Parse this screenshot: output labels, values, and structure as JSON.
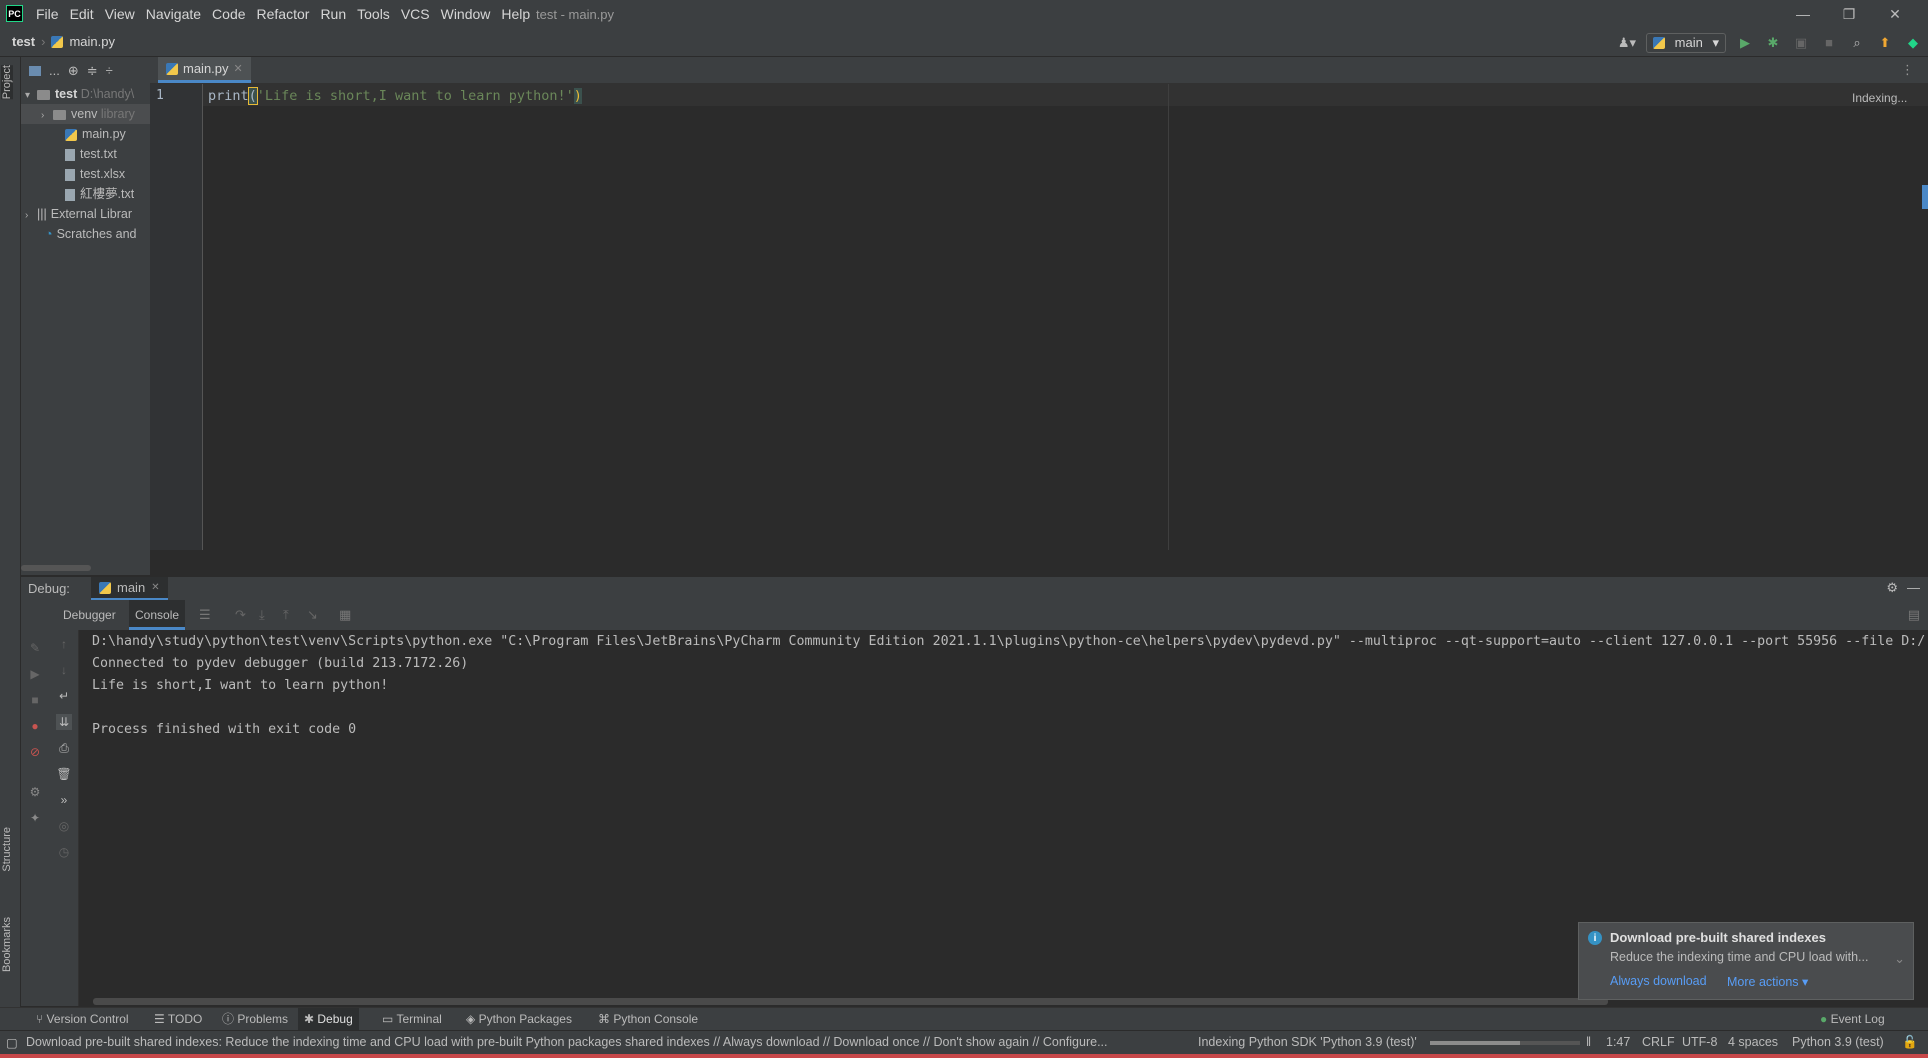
{
  "app": {
    "logo_text": "PC",
    "window_title": "test - main.py",
    "accent_color": "#4a88c7"
  },
  "menu": {
    "items": [
      "File",
      "Edit",
      "View",
      "Navigate",
      "Code",
      "Refactor",
      "Run",
      "Tools",
      "VCS",
      "Window",
      "Help"
    ]
  },
  "window_controls": {
    "minimize": "—",
    "restore": "❐",
    "close": "✕"
  },
  "navbar": {
    "project": "test",
    "file": "main.py",
    "run_config": "main"
  },
  "sidebar": {
    "project_tab": "Project",
    "structure_tab": "Structure",
    "bookmarks_tab": "Bookmarks"
  },
  "project_tree": {
    "root_name": "test",
    "root_path": "D:\\handy\\",
    "items": [
      {
        "name": "venv",
        "hint": "library"
      },
      {
        "name": "main.py"
      },
      {
        "name": "test.txt"
      },
      {
        "name": "test.xlsx"
      },
      {
        "name": "紅樓夢.txt"
      },
      {
        "name": "External Librar"
      },
      {
        "name": "Scratches and"
      }
    ],
    "toolbar_label": "..."
  },
  "editor": {
    "tab_label": "main.py",
    "line_number": "1",
    "code_func": "print",
    "code_open": "(",
    "code_string": "'Life is short,I want to learn python!'",
    "code_close": ")",
    "status_right": "Indexing..."
  },
  "debug": {
    "label": "Debug:",
    "session": "main",
    "subtab_debugger": "Debugger",
    "subtab_console": "Console",
    "console_lines": [
      "D:\\handy\\study\\python\\test\\venv\\Scripts\\python.exe \"C:\\Program Files\\JetBrains\\PyCharm Community Edition 2021.1.1\\plugins\\python-ce\\helpers\\pydev\\pydevd.py\" --multiproc --qt-support=auto --client 127.0.0.1 --port 55956 --file D:/",
      "Connected to pydev debugger (build 213.7172.26)",
      "Life is short,I want to learn python!",
      "",
      "Process finished with exit code 0"
    ]
  },
  "notification": {
    "title": "Download pre-built shared indexes",
    "body": "Reduce the indexing time and CPU load with...",
    "link_always": "Always download",
    "link_more": "More actions ▾"
  },
  "bottom_tabs": [
    "Version Control",
    "TODO",
    "Problems",
    "Debug",
    "Terminal",
    "Python Packages",
    "Python Console"
  ],
  "event_log": "Event Log",
  "status": {
    "message": "Download pre-built shared indexes: Reduce the indexing time and CPU load with pre-built Python packages shared indexes // Always download // Download once // Don't show again // Configure...",
    "indexing": "Indexing Python SDK 'Python 3.9 (test)'",
    "indexing_progress": 0.6,
    "position": "1:47",
    "line_sep": "CRLF",
    "encoding": "UTF-8",
    "indent": "4 spaces",
    "interpreter": "Python 3.9 (test)"
  }
}
